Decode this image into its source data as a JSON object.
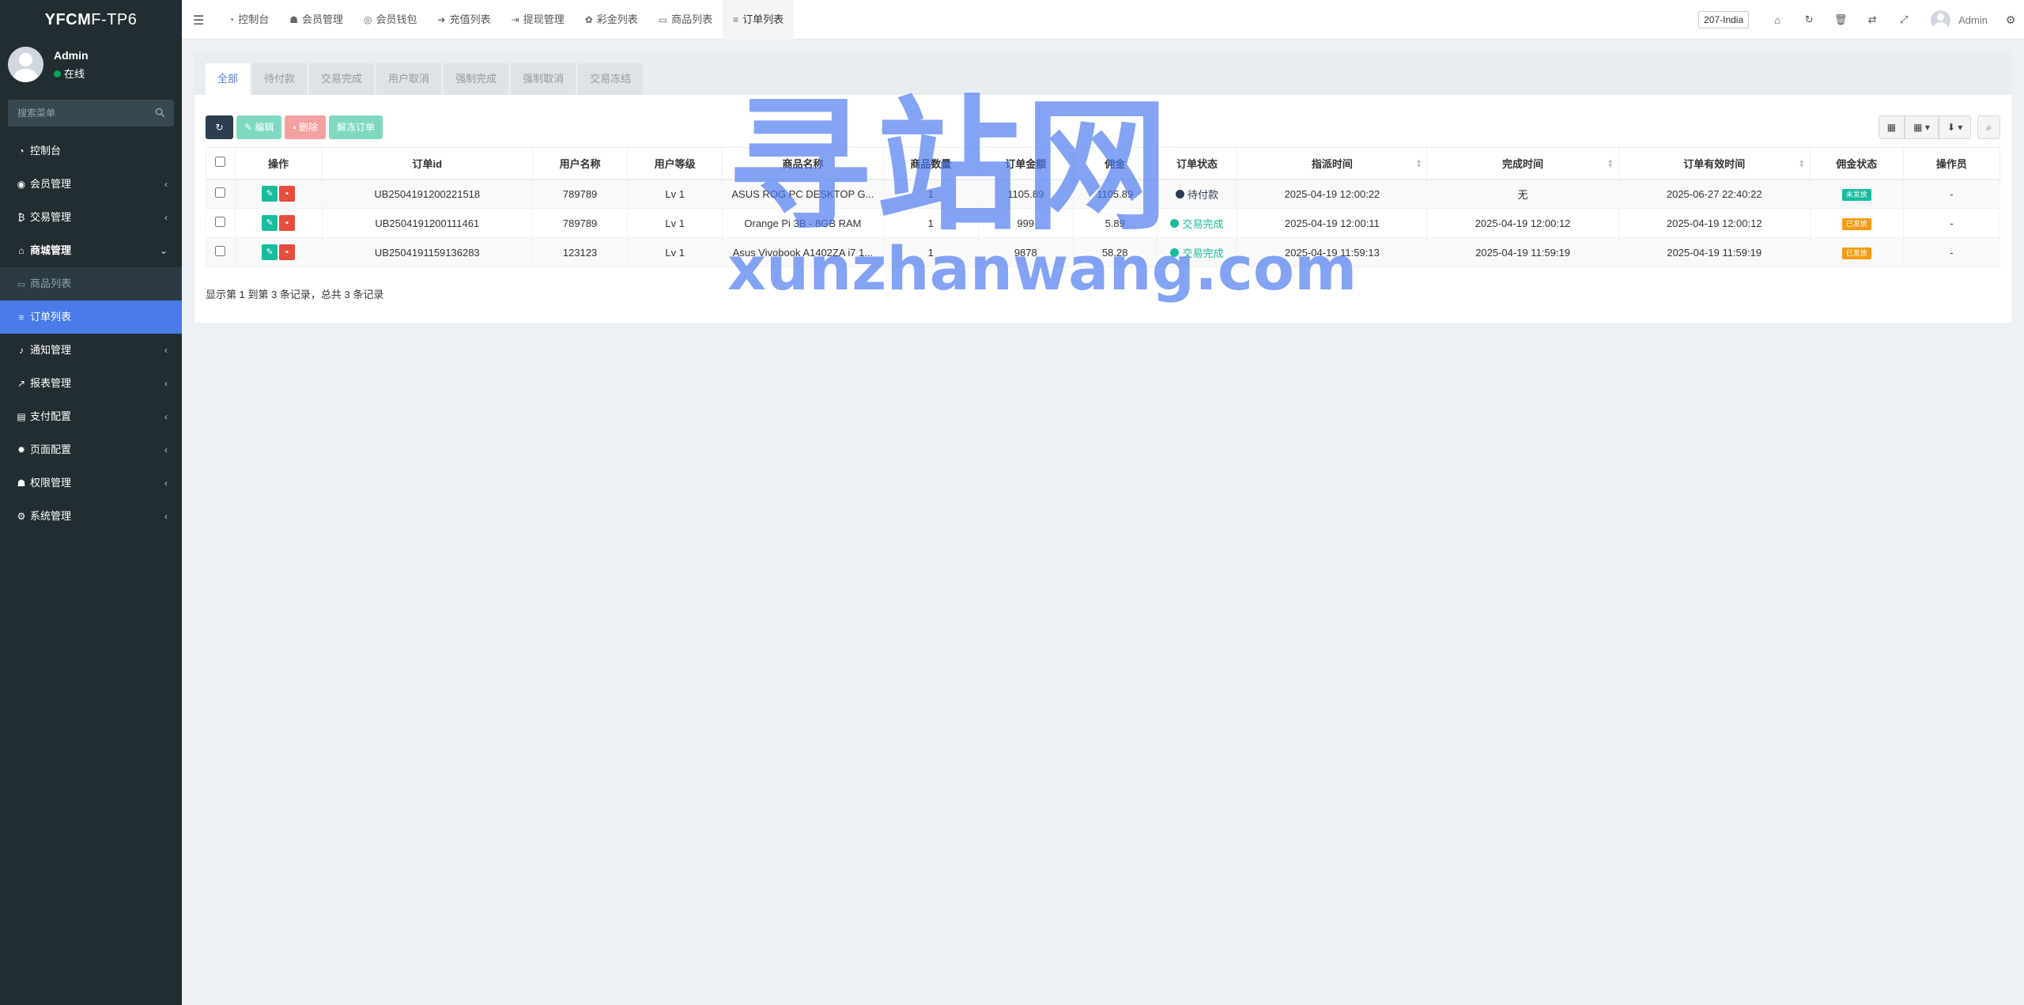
{
  "app": {
    "logo_bold": "YFCM",
    "logo_rest": "F-TP6"
  },
  "user": {
    "name": "Admin",
    "status": "在线"
  },
  "sidebar": {
    "search_placeholder": "搜索菜单",
    "items": [
      {
        "label": "控制台",
        "icon": "dashboard-icon",
        "glyph": "◔"
      },
      {
        "label": "会员管理",
        "icon": "user-icon",
        "glyph": "◉"
      },
      {
        "label": "交易管理",
        "icon": "bitcoin-icon",
        "glyph": "₿"
      },
      {
        "label": "商城管理",
        "icon": "home-icon",
        "glyph": "⌂"
      },
      {
        "label": "商品列表",
        "icon": "desktop-icon",
        "glyph": "▭"
      },
      {
        "label": "订单列表",
        "icon": "list-icon",
        "glyph": "≡"
      },
      {
        "label": "通知管理",
        "icon": "bell-icon",
        "glyph": "♪"
      },
      {
        "label": "报表管理",
        "icon": "line-chart-icon",
        "glyph": "↗"
      },
      {
        "label": "支付配置",
        "icon": "credit-card-icon",
        "glyph": "▤"
      },
      {
        "label": "页面配置",
        "icon": "cog-icon",
        "glyph": "✹"
      },
      {
        "label": "权限管理",
        "icon": "users-icon",
        "glyph": "☗"
      },
      {
        "label": "系统管理",
        "icon": "cogs-icon",
        "glyph": "⚙"
      }
    ]
  },
  "topbar": {
    "tabs": [
      {
        "label": "控制台",
        "icon": "dashboard-icon",
        "glyph": "◔"
      },
      {
        "label": "会员管理",
        "icon": "user-icon",
        "glyph": "☗"
      },
      {
        "label": "会员钱包",
        "icon": "wallet-icon",
        "glyph": "◎"
      },
      {
        "label": "充值列表",
        "icon": "sign-in-icon",
        "glyph": "➜"
      },
      {
        "label": "提现管理",
        "icon": "sign-out-icon",
        "glyph": "⇥"
      },
      {
        "label": "彩金列表",
        "icon": "gift-icon",
        "glyph": "✿"
      },
      {
        "label": "商品列表",
        "icon": "desktop-icon",
        "glyph": "▭"
      },
      {
        "label": "订单列表",
        "icon": "list-icon",
        "glyph": "≡"
      }
    ],
    "lang": "207-India",
    "user_name": "Admin"
  },
  "status_tabs": [
    "全部",
    "待付款",
    "交易完成",
    "用户取消",
    "强制完成",
    "强制取消",
    "交易冻结"
  ],
  "toolbar": {
    "edit": "编辑",
    "delete": "删除",
    "unfreeze": "解冻订单"
  },
  "table": {
    "headers": [
      "操作",
      "订单id",
      "用户名称",
      "用户等级",
      "商品名称",
      "商品数量",
      "订单金额",
      "佣金",
      "订单状态",
      "指派时间",
      "完成时间",
      "订单有效时间",
      "佣金状态",
      "操作员"
    ],
    "rows": [
      {
        "id": "UB2504191200221518",
        "username": "789789",
        "level": "Lv 1",
        "product": "ASUS ROG PC DESKTOP G...",
        "qty": "1",
        "amount": "1105.89",
        "commission": "1105.89",
        "status": "待付款",
        "status_color": "#2c3e50",
        "assigned": "2025-04-19 12:00:22",
        "completed": "无",
        "valid": "2025-06-27 22:40:22",
        "comm_status": "未发放",
        "comm_color": "#18bc9c",
        "operator": "-"
      },
      {
        "id": "UB2504191200111461",
        "username": "789789",
        "level": "Lv 1",
        "product": "Orange Pi 3B - 8GB RAM",
        "qty": "1",
        "amount": "999",
        "commission": "5.89",
        "status": "交易完成",
        "status_color": "#18bc9c",
        "assigned": "2025-04-19 12:00:11",
        "completed": "2025-04-19 12:00:12",
        "valid": "2025-04-19 12:00:12",
        "comm_status": "已发放",
        "comm_color": "#f39c12",
        "operator": "-"
      },
      {
        "id": "UB2504191159136283",
        "username": "123123",
        "level": "Lv 1",
        "product": "Asus Vivobook A1402ZA i7 1...",
        "qty": "1",
        "amount": "9878",
        "commission": "58.28",
        "status": "交易完成",
        "status_color": "#18bc9c",
        "assigned": "2025-04-19 11:59:13",
        "completed": "2025-04-19 11:59:19",
        "valid": "2025-04-19 11:59:19",
        "comm_status": "已发放",
        "comm_color": "#f39c12",
        "operator": "-"
      }
    ]
  },
  "summary": "显示第 1 到第 3 条记录，总共 3 条记录",
  "watermark": {
    "cn": "寻站网",
    "en": "xunzhanwang.com"
  }
}
